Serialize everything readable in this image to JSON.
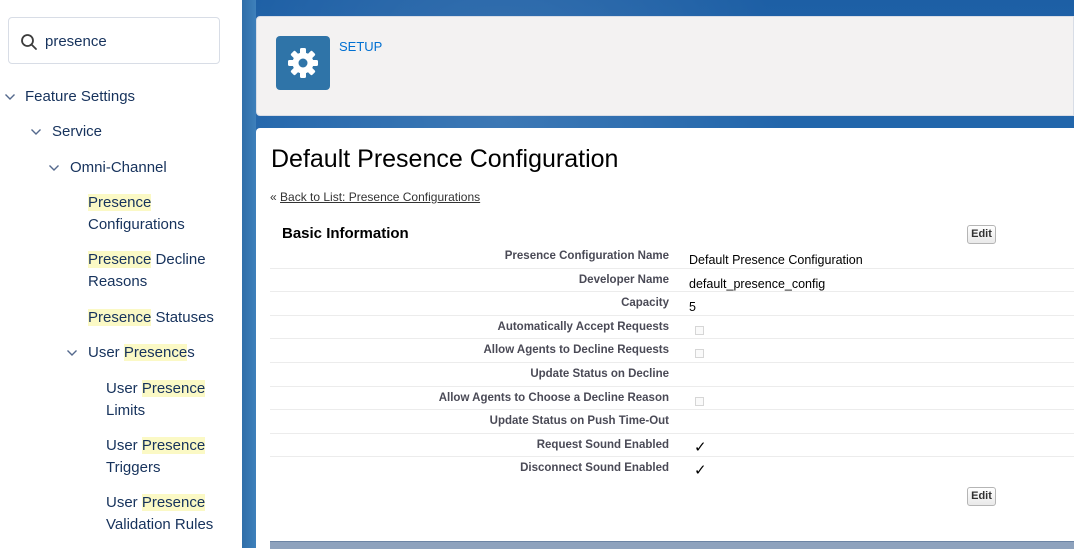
{
  "sidebar": {
    "search": {
      "value": "presence",
      "placeholder": ""
    },
    "tree": {
      "feature_settings": "Feature Settings",
      "service": "Service",
      "omni_channel": "Omni-Channel",
      "presence_configurations": {
        "hl": "Presence",
        "rest": "Configurations"
      },
      "presence_decline_reasons": {
        "hl": "Presence",
        "rest1": " Decline",
        "rest2": "Reasons"
      },
      "presence_statuses": {
        "hl": "Presence",
        "rest": " Statuses"
      },
      "user_presences": {
        "pre": "User ",
        "hl": "Presence",
        "rest": "s"
      },
      "user_presence_limits": {
        "pre": "User ",
        "hl": "Presence",
        "rest": "Limits"
      },
      "user_presence_triggers": {
        "pre": "User ",
        "hl": "Presence",
        "rest": "Triggers"
      },
      "user_presence_validation_rules": {
        "pre": "User ",
        "hl": "Presence",
        "rest": "Validation Rules"
      }
    }
  },
  "header": {
    "setup_label": "SETUP",
    "icon": "gear-icon"
  },
  "page": {
    "title": "Default Presence Configuration",
    "back_prefix": "«",
    "back_link": "Back to List: Presence Configurations",
    "section_title": "Basic Information",
    "edit_label": "Edit",
    "fields": [
      {
        "label": "Presence Configuration Name",
        "value": "Default Presence Configuration",
        "kind": "text"
      },
      {
        "label": "Developer Name",
        "value": "default_presence_config",
        "kind": "text"
      },
      {
        "label": "Capacity",
        "value": "5",
        "kind": "text"
      },
      {
        "label": "Automatically Accept Requests",
        "value": "unchecked",
        "kind": "checkbox"
      },
      {
        "label": "Allow Agents to Decline Requests",
        "value": "unchecked",
        "kind": "checkbox"
      },
      {
        "label": "Update Status on Decline",
        "value": "",
        "kind": "text"
      },
      {
        "label": "Allow Agents to Choose a Decline Reason",
        "value": "unchecked",
        "kind": "checkbox"
      },
      {
        "label": "Update Status on Push Time-Out",
        "value": "",
        "kind": "text"
      },
      {
        "label": "Request Sound Enabled",
        "value": "✓",
        "kind": "check"
      },
      {
        "label": "Disconnect Sound Enabled",
        "value": "✓",
        "kind": "check"
      }
    ]
  },
  "colors": {
    "link": "#0070d2",
    "highlight": "#fbf9c5",
    "setup_tile": "#2f74a8",
    "sidebar_text": "#16325c"
  }
}
